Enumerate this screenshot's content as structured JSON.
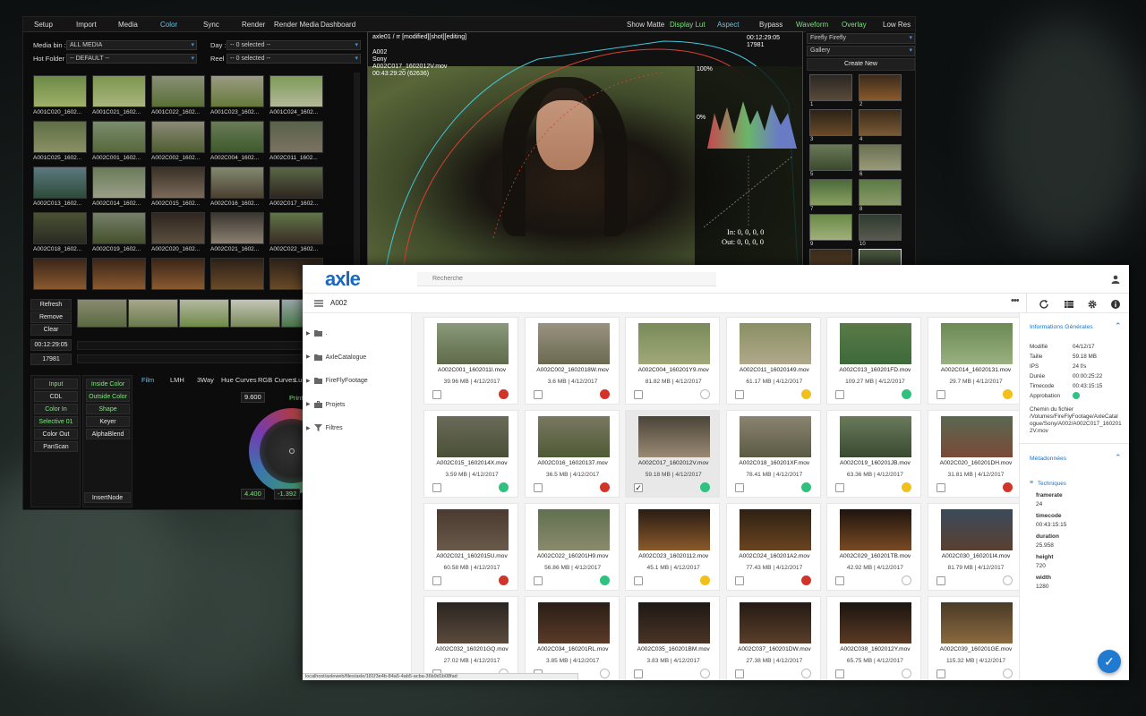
{
  "grading": {
    "menu": [
      "Setup",
      "Import",
      "Media",
      "Color",
      "Sync",
      "Render",
      "Render Media",
      "Dashboard"
    ],
    "menu_right": [
      "Show Matte",
      "Display Lut",
      "Aspect",
      "Bypass",
      "Waveform",
      "Overlay",
      "Low Res"
    ],
    "media_bin_label": "Media bin :",
    "media_bin_value": "ALL MEDIA",
    "hot_folder_label": "Hot Folder :",
    "hot_folder_value": "-- DEFAULT --",
    "day_label": "Day :",
    "day_value": "-- 0 selected --",
    "reel_label": "Reel :",
    "reel_value": "-- 0 selected --",
    "bin_clips": [
      "A001C020_1602...",
      "A001C021_1602...",
      "A001C022_1602...",
      "A001C023_1602...",
      "A001C024_1602...",
      "A001C025_1602...",
      "A002C001_1602...",
      "A002C002_1602...",
      "A002C004_1602...",
      "A002C011_1602...",
      "A002C013_1602...",
      "A002C014_1602...",
      "A002C015_1602...",
      "A002C016_1602...",
      "A002C017_1602...",
      "A002C018_1602...",
      "A002C019_1602...",
      "A002C020_1602...",
      "A002C021_1602...",
      "A002C022_1602..."
    ],
    "buttons": [
      "Refresh",
      "Remove",
      "Clear"
    ],
    "timecode": "00:12:29:05",
    "frame": "17981",
    "nodes_left": [
      "Input",
      "CDL",
      "Color In",
      "Selective 01",
      "Color Out",
      "PanScan"
    ],
    "nodes_right": [
      "Inside Color",
      "Outside Color",
      "Shape",
      "Keyer",
      "AlphaBlend"
    ],
    "insert_node": "InsertNode",
    "tabs": [
      "Film",
      "LMH",
      "3Way",
      "Hue Curves",
      "RGB Curves",
      "Lu"
    ],
    "val_top": "9.600",
    "print_label": "Print",
    "val_bottom_left": "4.400",
    "val_bottom_right": "-1.392",
    "viewer": {
      "title": "axle01 / rr [modified][shot][editing]",
      "camera": "A002",
      "maker": "Sony",
      "clip": "A002C017_1602012V.mov",
      "tc": "00:43:29:20 (62636)",
      "tc_right": "00:12:29:05",
      "frame_right": "17981",
      "in": "In: 0, 0, 0, 0",
      "out": "Out: 0, 0, 0, 0",
      "pct_top": "100%",
      "pct_bottom": "0%"
    },
    "right_panel": {
      "project": "Firefly Firefly",
      "gallery": "Gallery",
      "create": "Create New",
      "thumb_labels": [
        "1",
        "2",
        "3",
        "4",
        "5",
        "6",
        "7",
        "8",
        "9",
        "10"
      ]
    }
  },
  "axle": {
    "logo": "axle",
    "search_placeholder": "Recherche",
    "breadcrumb": "A002",
    "tree": [
      ".",
      "AxleCatalogue",
      "FireFlyFootage",
      "Projets",
      "Filtres"
    ],
    "files": [
      {
        "name": "A002C001_1602011I.mov",
        "meta": "39.96 MB | 4/12/2017",
        "status": "#d2342a",
        "checked": false,
        "sel": false
      },
      {
        "name": "A002C002_1602018W.mov",
        "meta": "3.6 MB | 4/12/2017",
        "status": "#d2342a",
        "checked": false,
        "sel": false
      },
      {
        "name": "A002C004_160201Y9.mov",
        "meta": "81.82 MB | 4/12/2017",
        "status": "#ffffff",
        "checked": false,
        "sel": false
      },
      {
        "name": "A002C011_16020149.mov",
        "meta": "61.17 MB | 4/12/2017",
        "status": "#f2c01b",
        "checked": false,
        "sel": false
      },
      {
        "name": "A002C013_160201FD.mov",
        "meta": "109.27 MB | 4/12/2017",
        "status": "#2ec27e",
        "checked": false,
        "sel": false
      },
      {
        "name": "A002C014_16020131.mov",
        "meta": "29.7 MB | 4/12/2017",
        "status": "#f2c01b",
        "checked": false,
        "sel": false
      },
      {
        "name": "A002C015_1602014X.mov",
        "meta": "3.59 MB | 4/12/2017",
        "status": "#2ec27e",
        "checked": false,
        "sel": false
      },
      {
        "name": "A002C016_16020137.mov",
        "meta": "36.5 MB | 4/12/2017",
        "status": "#d2342a",
        "checked": false,
        "sel": false
      },
      {
        "name": "A002C017_1602012V.mov",
        "meta": "59.18 MB | 4/12/2017",
        "status": "#2ec27e",
        "checked": true,
        "sel": true
      },
      {
        "name": "A002C018_160201XF.mov",
        "meta": "78.41 MB | 4/12/2017",
        "status": "#2ec27e",
        "checked": false,
        "sel": false
      },
      {
        "name": "A002C019_160201JB.mov",
        "meta": "63.36 MB | 4/12/2017",
        "status": "#f2c01b",
        "checked": false,
        "sel": false
      },
      {
        "name": "A002C020_160201DH.mov",
        "meta": "31.81 MB | 4/12/2017",
        "status": "#d2342a",
        "checked": false,
        "sel": false
      },
      {
        "name": "A002C021_1602015U.mov",
        "meta": "60.58 MB | 4/12/2017",
        "status": "#d2342a",
        "checked": false,
        "sel": false
      },
      {
        "name": "A002C022_160201H9.mov",
        "meta": "56.86 MB | 4/12/2017",
        "status": "#2ec27e",
        "checked": false,
        "sel": false
      },
      {
        "name": "A002C023_16020112.mov",
        "meta": "45.1 MB | 4/12/2017",
        "status": "#f2c01b",
        "checked": false,
        "sel": false
      },
      {
        "name": "A002C024_160201A2.mov",
        "meta": "77.43 MB | 4/12/2017",
        "status": "#d2342a",
        "checked": false,
        "sel": false
      },
      {
        "name": "A002C029_160201TB.mov",
        "meta": "42.92 MB | 4/12/2017",
        "status": "#ffffff",
        "checked": false,
        "sel": false
      },
      {
        "name": "A002C030_160201I4.mov",
        "meta": "81.79 MB | 4/12/2017",
        "status": "#ffffff",
        "checked": false,
        "sel": false
      },
      {
        "name": "A002C032_160201GQ.mov",
        "meta": "27.02 MB | 4/12/2017",
        "status": "#ffffff",
        "checked": false,
        "sel": false
      },
      {
        "name": "A002C034_160201RL.mov",
        "meta": "3.85 MB | 4/12/2017",
        "status": "#ffffff",
        "checked": false,
        "sel": false
      },
      {
        "name": "A002C035_160201BM.mov",
        "meta": "3.83 MB | 4/12/2017",
        "status": "#ffffff",
        "checked": false,
        "sel": false
      },
      {
        "name": "A002C037_160201DW.mov",
        "meta": "27.38 MB | 4/12/2017",
        "status": "#ffffff",
        "checked": false,
        "sel": false
      },
      {
        "name": "A002C038_1602012Y.mov",
        "meta": "65.75 MB | 4/12/2017",
        "status": "#ffffff",
        "checked": false,
        "sel": false
      },
      {
        "name": "A002C039_160201GE.mov",
        "meta": "115.32 MB | 4/12/2017",
        "status": "#ffffff",
        "checked": false,
        "sel": false
      }
    ],
    "info": {
      "general_title": "Informations Générales",
      "rows": [
        {
          "k": "Modifié",
          "v": "04/12/17"
        },
        {
          "k": "Taille",
          "v": "59.18 MB"
        },
        {
          "k": "IPS",
          "v": "24 f/s"
        },
        {
          "k": "Durée",
          "v": "00:00:25:22"
        },
        {
          "k": "Timecode",
          "v": "00:43:15:15"
        },
        {
          "k": "Approbation",
          "v": ""
        }
      ],
      "path_label": "Chemin du fichier",
      "path_lines": [
        "/Volumes/FireFlyFootage/AxleCatal",
        "ogue/Sony/A002/A002C017_160201",
        "2V.mov"
      ],
      "meta_title": "Métadonnées",
      "tech_title": "Techniques",
      "tech": [
        {
          "k": "framerate",
          "v": "24"
        },
        {
          "k": "timecode",
          "v": "00:43:15:15"
        },
        {
          "k": "duration",
          "v": "25.958"
        },
        {
          "k": "height",
          "v": "720"
        },
        {
          "k": "width",
          "v": "1280"
        }
      ]
    },
    "status_url": "localhost/axleweb/files/axle/181f3e4b-84a5-4ab5-acba-36b9d1b08fad"
  }
}
